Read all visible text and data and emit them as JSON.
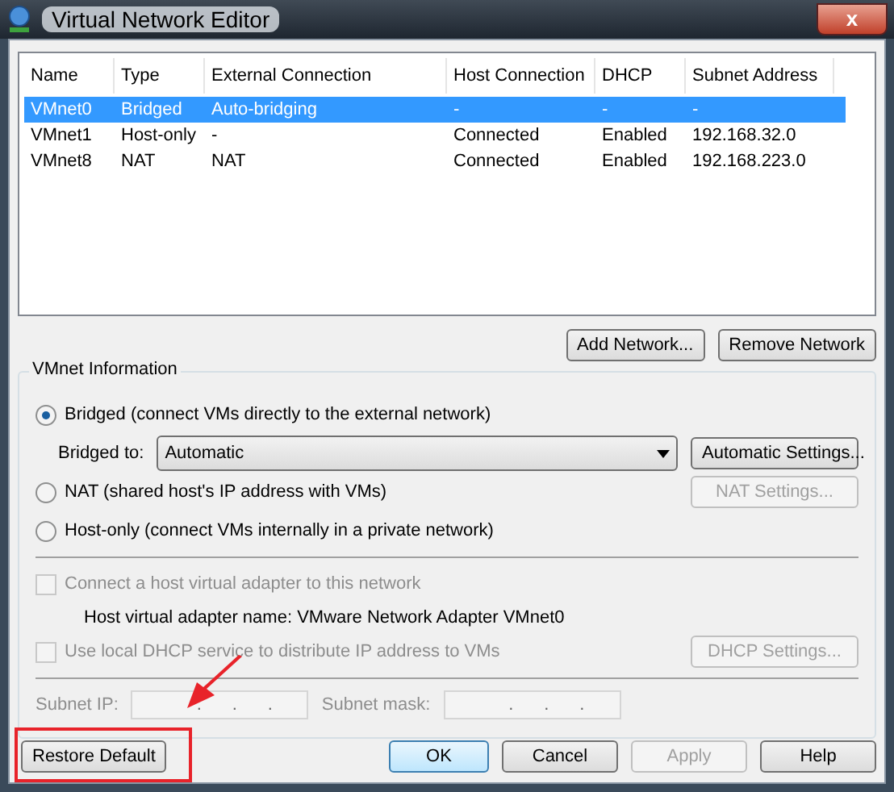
{
  "window": {
    "title": "Virtual Network Editor",
    "close": "x"
  },
  "table": {
    "columns": [
      "Name",
      "Type",
      "External Connection",
      "Host Connection",
      "DHCP",
      "Subnet Address"
    ],
    "rows": [
      {
        "cells": [
          "VMnet0",
          "Bridged",
          "Auto-bridging",
          "-",
          "-",
          "-"
        ],
        "selected": true
      },
      {
        "cells": [
          "VMnet1",
          "Host-only",
          "-",
          "Connected",
          "Enabled",
          "192.168.32.0"
        ],
        "selected": false
      },
      {
        "cells": [
          "VMnet8",
          "NAT",
          "NAT",
          "Connected",
          "Enabled",
          "192.168.223.0"
        ],
        "selected": false
      }
    ]
  },
  "table_buttons": [
    {
      "label": "Add Network..."
    },
    {
      "label": "Remove Network"
    }
  ],
  "vmnet_info": {
    "title": "VMnet Information",
    "bridged": {
      "label": "Bridged (connect VMs directly to the external network)",
      "selected": true
    },
    "bridged_to": {
      "label": "Bridged to:",
      "value": "Automatic",
      "button": {
        "label": "Automatic Settings..."
      }
    },
    "nat": {
      "label": "NAT (shared host's IP address with VMs)",
      "selected": false,
      "button": {
        "label": "NAT Settings...",
        "disabled": true
      }
    },
    "host_only": {
      "label": "Host-only (connect VMs internally in a private network)",
      "selected": false
    },
    "connect_adapter": {
      "label": "Connect a host virtual adapter to this network",
      "checked": false,
      "disabled": true
    },
    "adapter_name": "Host virtual adapter name: VMware Network Adapter VMnet0",
    "dhcp": {
      "label": "Use local DHCP service to distribute IP address to VMs",
      "checked": false,
      "disabled": true,
      "button": {
        "label": "DHCP Settings...",
        "disabled": true
      }
    },
    "subnet_ip": {
      "label": "Subnet IP:",
      "dots": [
        ".",
        ".",
        "."
      ]
    },
    "subnet_mask": {
      "label": "Subnet mask:",
      "dots": [
        ".",
        ".",
        "."
      ]
    }
  },
  "bottom": {
    "restore": {
      "label": "Restore Default",
      "highlighted": true
    },
    "buttons": [
      {
        "label": "OK",
        "disabled": false,
        "default": true
      },
      {
        "label": "Cancel",
        "disabled": false,
        "default": false
      },
      {
        "label": "Apply",
        "disabled": true,
        "default": false
      },
      {
        "label": "Help",
        "disabled": false,
        "default": false
      }
    ]
  }
}
